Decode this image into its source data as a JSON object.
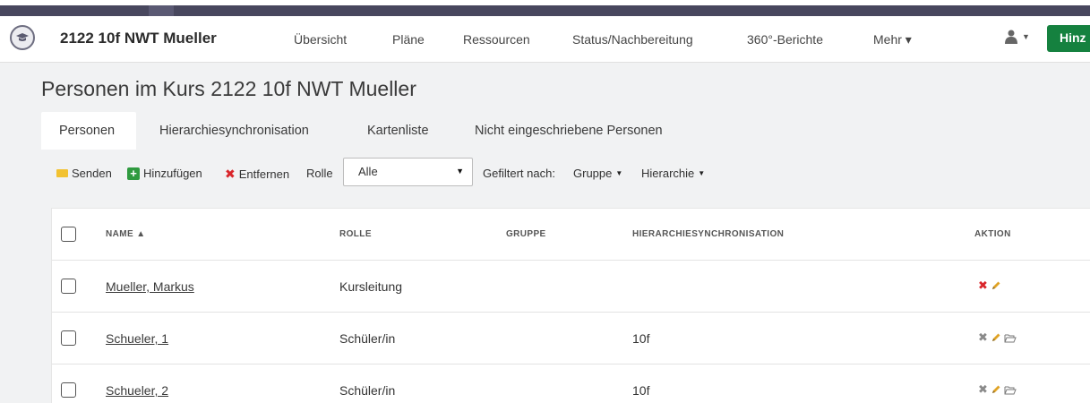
{
  "header": {
    "course_title": "2122 10f NWT Mueller",
    "nav": [
      "Übersicht",
      "Pläne",
      "Ressourcen",
      "Status/Nachbereitung",
      "360°-Berichte",
      "Mehr ▾"
    ],
    "add_label": "Hinz"
  },
  "page": {
    "title": "Personen im Kurs 2122 10f NWT Mueller"
  },
  "tabs": [
    "Personen",
    "Hierarchiesynchronisation",
    "Kartenliste",
    "Nicht eingeschriebene Personen"
  ],
  "toolbar": {
    "send": "Senden",
    "add": "Hinzufügen",
    "remove": "Entfernen",
    "role_label": "Rolle",
    "role_value": "Alle",
    "filtered_by": "Gefiltert nach:",
    "group_filter": "Gruppe",
    "hierarchy_filter": "Hierarchie"
  },
  "table": {
    "columns": {
      "name": "NAME",
      "role": "ROLLE",
      "group": "GRUPPE",
      "hierarchy": "HIERARCHIESYNCHRONISATION",
      "action": "AKTION"
    },
    "rows": [
      {
        "name": "Mueller, Markus",
        "role": "Kursleitung",
        "group": "",
        "hierarchy": ""
      },
      {
        "name": "Schueler, 1",
        "role": "Schüler/in",
        "group": "",
        "hierarchy": "10f"
      },
      {
        "name": "Schueler, 2",
        "role": "Schüler/in",
        "group": "",
        "hierarchy": "10f"
      }
    ]
  },
  "colors": {
    "topbar": "#48475e",
    "add_button": "#15813f",
    "delete_active": "#d9262b",
    "delete_inactive": "#8a8a8a",
    "edit_pencil": "#e0a325"
  }
}
